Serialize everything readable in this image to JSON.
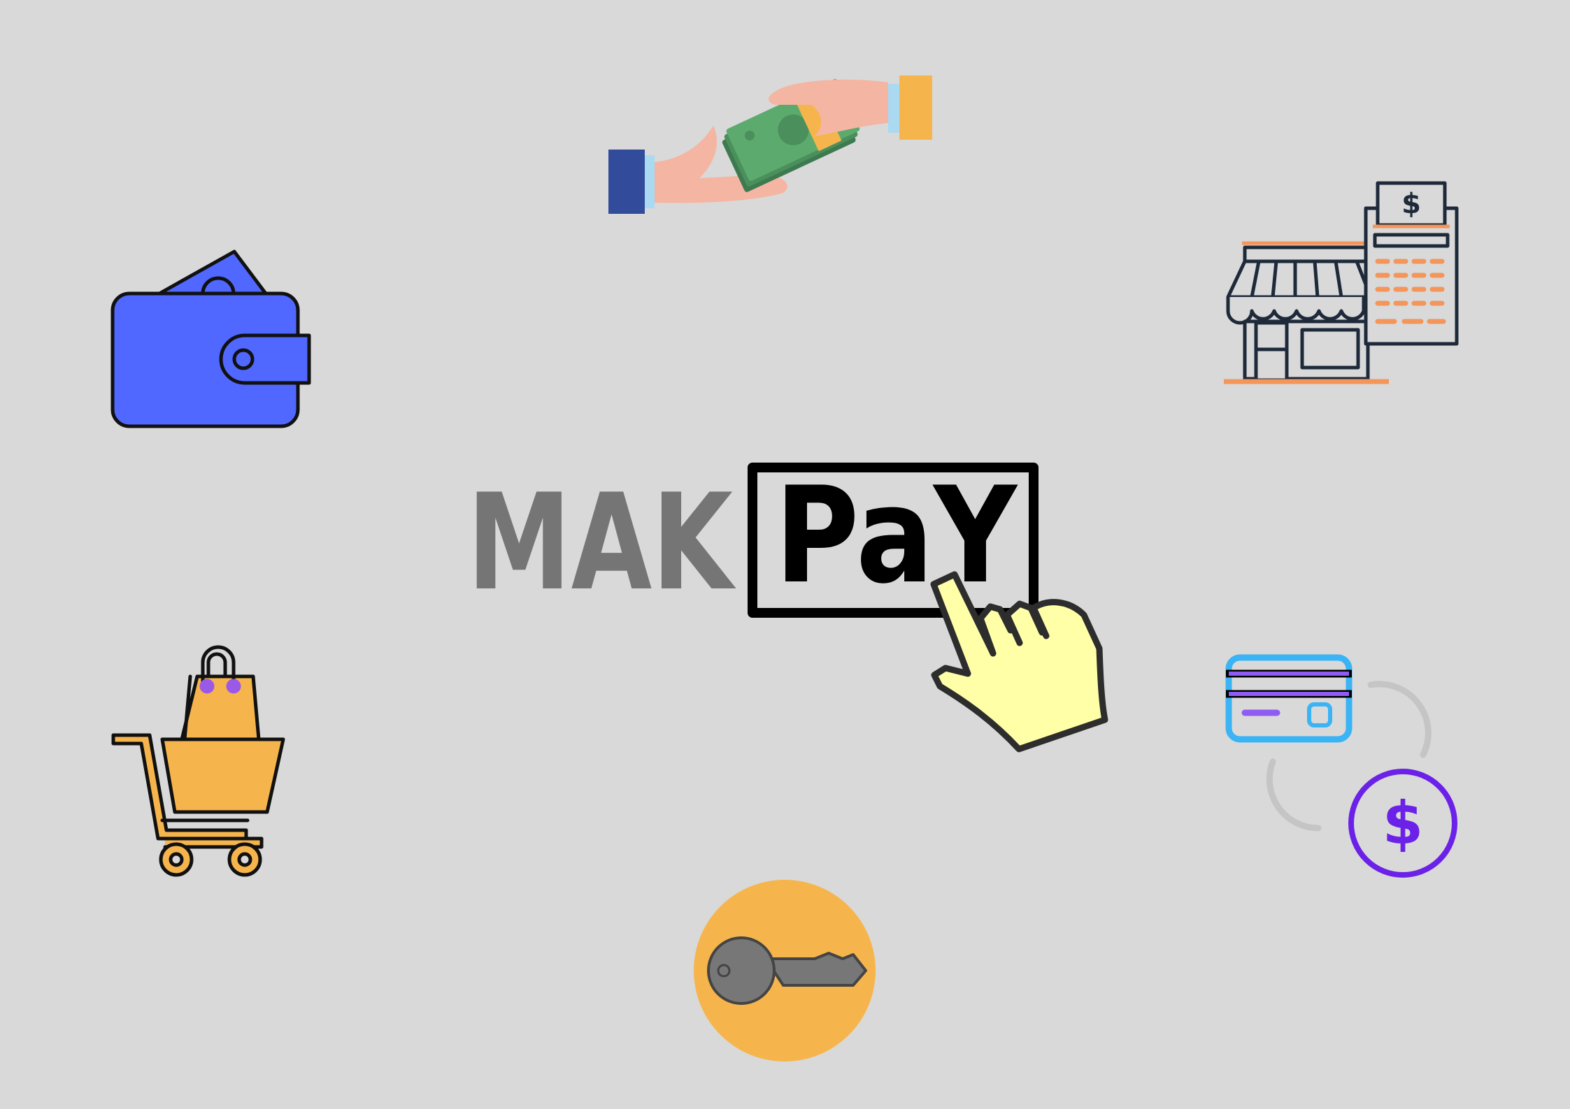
{
  "background_color": "#d9d9d9",
  "logo": {
    "left_text": "MAK",
    "right_text": "PaY",
    "left_color": "#757575",
    "right_color": "#000000"
  },
  "icons": [
    "wallet-icon",
    "cash-handover-icon",
    "storefront-receipt-icon",
    "shopping-cart-icon",
    "card-to-coin-exchange-icon",
    "key-icon",
    "pointing-hand-cursor-icon"
  ],
  "colors": {
    "wallet": "#5068ff",
    "accent_orange": "#f6b54c",
    "cash_green": "#4a8f5c",
    "cursor_hand": "#ffffa8",
    "card_outline": "#3ab4f5",
    "coin_purple": "#6b21e8",
    "store_orange": "#f4955a",
    "key_grey": "#777777"
  }
}
